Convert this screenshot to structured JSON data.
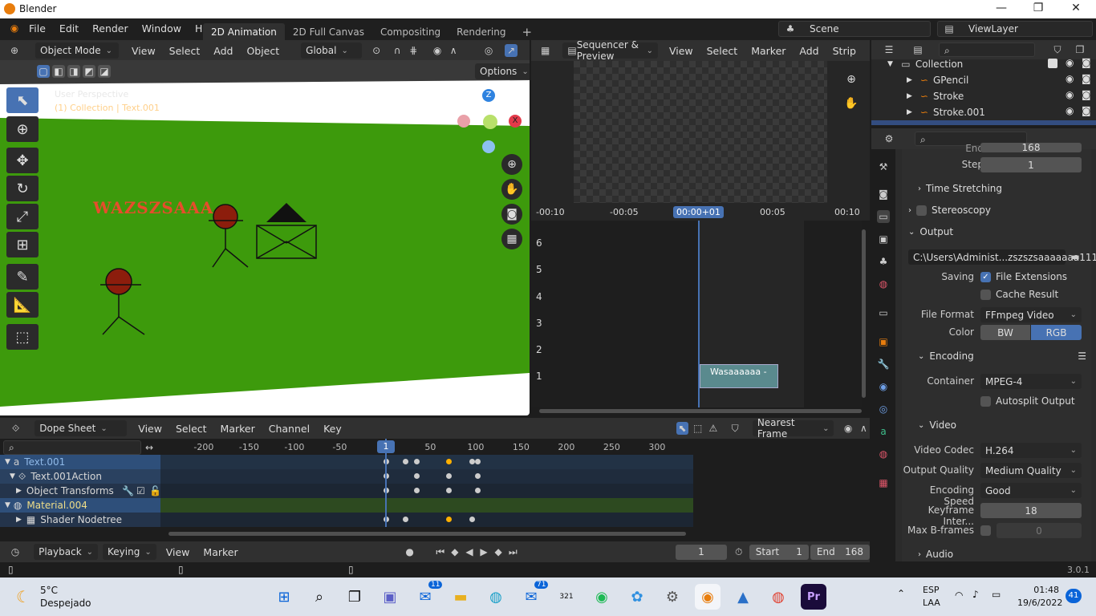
{
  "window": {
    "title": "Blender",
    "minimize": "—",
    "maximize": "❐",
    "close": "✕"
  },
  "menus": [
    "File",
    "Edit",
    "Render",
    "Window",
    "Help"
  ],
  "workspaces": [
    "2D Animation",
    "2D Full Canvas",
    "Compositing",
    "Rendering"
  ],
  "workspace_add": "+",
  "scene": {
    "label": "Scene",
    "view_layer": "ViewLayer"
  },
  "viewport": {
    "mode": "Object Mode",
    "menus": [
      "View",
      "Select",
      "Add",
      "Object"
    ],
    "orientation": "Global",
    "options": "Options",
    "overlay_line1": "User Perspective",
    "overlay_line2": "(1) Collection | Text.001",
    "text_object": "WAZSZSAAA",
    "gizmo": {
      "z": "Z",
      "x": "X"
    }
  },
  "sequencer": {
    "mode": "Sequencer & Preview",
    "menus": [
      "View",
      "Select",
      "Marker",
      "Add",
      "Strip"
    ],
    "time_labels": [
      "-00:10",
      "-00:05",
      "00:00+01",
      "00:05",
      "00:10"
    ],
    "channels": [
      "6",
      "5",
      "4",
      "3",
      "2",
      "1"
    ],
    "strip_label": "Wasaaaaaa -"
  },
  "outliner": {
    "collection": "Collection",
    "items": [
      "GPencil",
      "Stroke",
      "Stroke.001"
    ]
  },
  "properties": {
    "top_label": "End",
    "top_value": "168",
    "step_label": "Step",
    "step_value": "1",
    "time_stretching": "Time Stretching",
    "stereoscopy": "Stereoscopy",
    "output": "Output",
    "output_path": "C:\\Users\\Administ...zszszsaaaaaaa111",
    "saving": "Saving",
    "file_extensions": "File Extensions",
    "cache_result": "Cache Result",
    "file_format_label": "File Format",
    "file_format": "FFmpeg Video",
    "color_label": "Color",
    "color_bw": "BW",
    "color_rgb": "RGB",
    "encoding": "Encoding",
    "container_label": "Container",
    "container": "MPEG-4",
    "autosplit": "Autosplit Output",
    "video": "Video",
    "codec_label": "Video Codec",
    "codec": "H.264",
    "quality_label": "Output Quality",
    "quality": "Medium Quality",
    "speed_label": "Encoding Speed",
    "speed": "Good",
    "keyframe_label": "Keyframe Inter...",
    "keyframe": "18",
    "bframes_label": "Max B-frames",
    "bframes": "0",
    "audio": "Audio"
  },
  "dopesheet": {
    "mode": "Dope Sheet",
    "menus": [
      "View",
      "Select",
      "Marker",
      "Channel",
      "Key"
    ],
    "snap": "Nearest Frame",
    "frame_ticks": [
      "-200",
      "-150",
      "-100",
      "-50",
      "1",
      "50",
      "100",
      "150",
      "200",
      "250",
      "300"
    ],
    "frame_tick_values": [
      -200,
      -150,
      -100,
      -50,
      1,
      50,
      100,
      150,
      200,
      250,
      300
    ],
    "current_frame": 1,
    "channels": [
      {
        "label": "Text.001",
        "level": 0,
        "kind": "object"
      },
      {
        "label": "Text.001Action",
        "level": 1,
        "kind": "action"
      },
      {
        "label": "Object Transforms",
        "level": 2,
        "kind": "group"
      },
      {
        "label": "Material.004",
        "level": 0,
        "kind": "material"
      },
      {
        "label": "Shader Nodetree",
        "level": 2,
        "kind": "group"
      }
    ],
    "keyframes": [
      {
        "row": 0,
        "frames": [
          1,
          22,
          35,
          70,
          96,
          102
        ],
        "selected": [
          70
        ]
      },
      {
        "row": 1,
        "frames": [
          1,
          35,
          70,
          102
        ],
        "selected": []
      },
      {
        "row": 2,
        "frames": [
          1,
          35,
          70,
          102
        ],
        "selected": []
      },
      {
        "row": 4,
        "frames": [
          1,
          22,
          70,
          96
        ],
        "selected": [
          70
        ]
      }
    ]
  },
  "timeline": {
    "menus": [
      "Playback",
      "Keying",
      "View",
      "Marker"
    ],
    "current_frame": "1",
    "start_label": "Start",
    "start": "1",
    "end_label": "End",
    "end": "168"
  },
  "status": {
    "version": "3.0.1"
  },
  "taskbar": {
    "weather_temp": "5°C",
    "weather_desc": "Despejado",
    "badge_outlook": "11",
    "badge_mail": "71",
    "calendar_num": "321",
    "lang1": "ESP",
    "lang2": "LAA",
    "time": "01:48",
    "date": "19/6/2022",
    "notif": "41"
  }
}
